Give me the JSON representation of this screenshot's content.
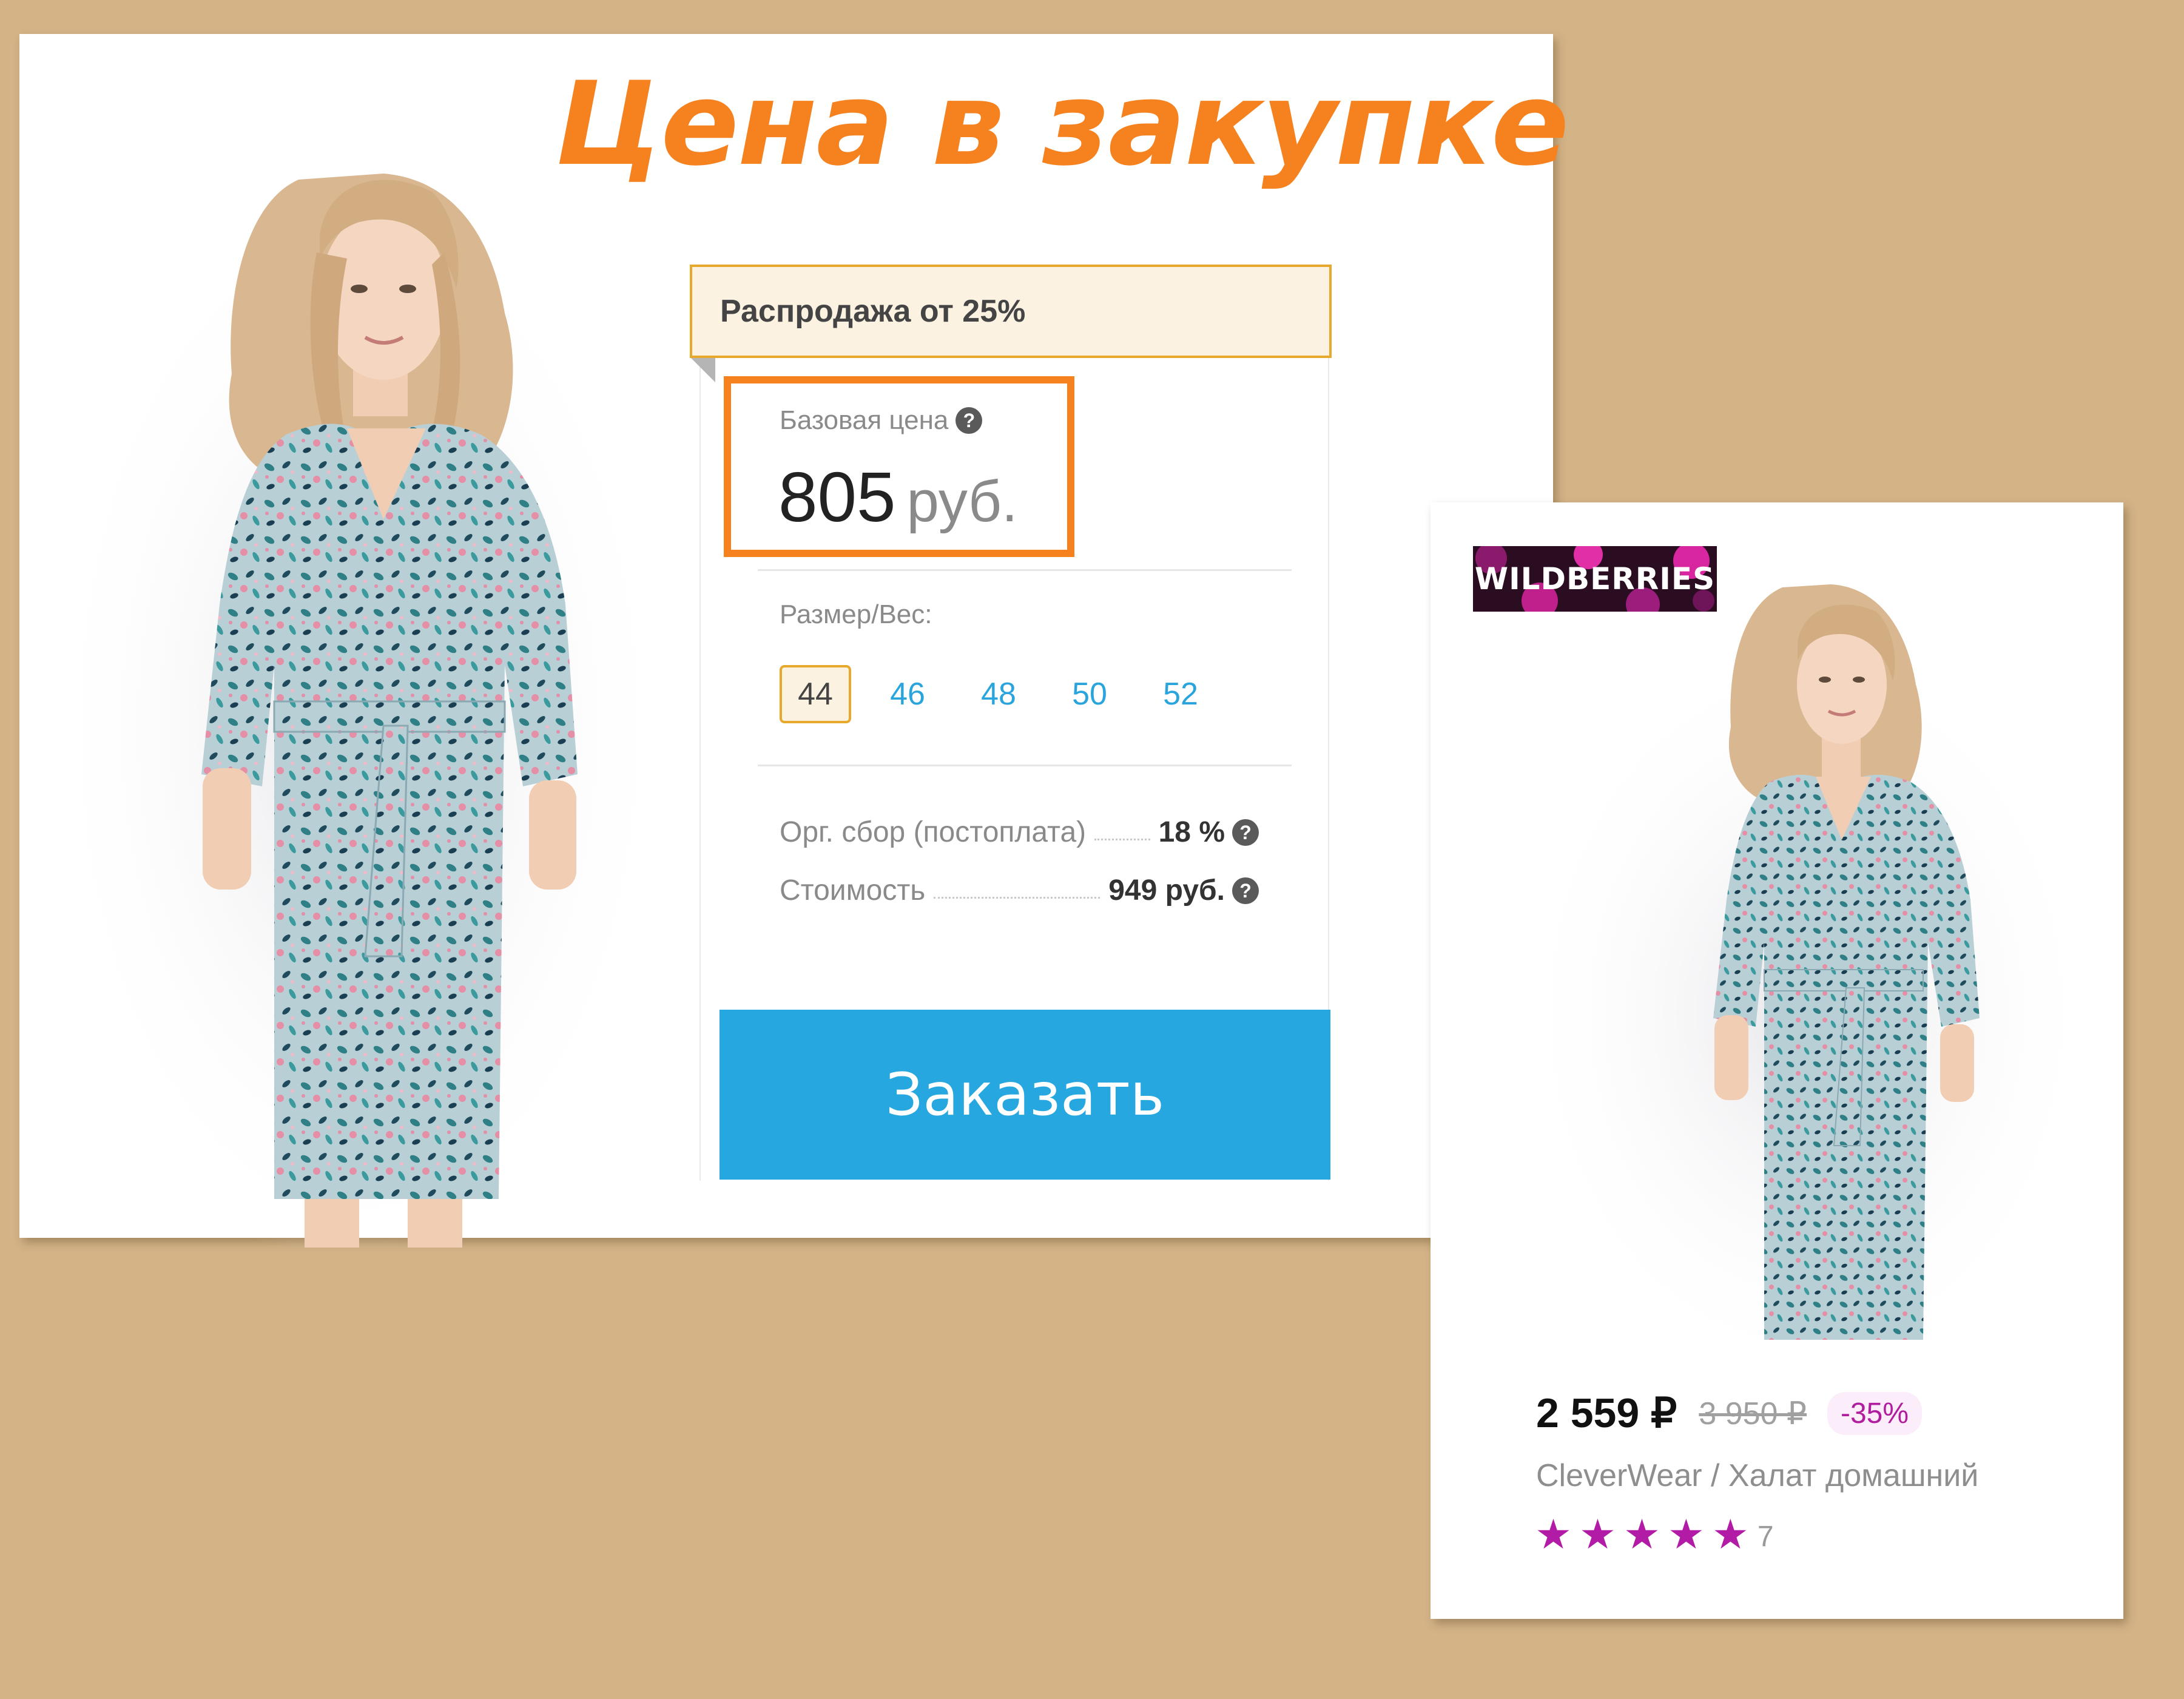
{
  "hero": {
    "title": "Цена в закупке"
  },
  "purchase": {
    "sale_banner": "Распродажа от 25%",
    "base_price_label": "Базовая цена",
    "base_price_amount": "805",
    "base_price_currency": "руб.",
    "size_label": "Размер/Вес:",
    "sizes": [
      "44",
      "46",
      "48",
      "50",
      "52"
    ],
    "selected_size": "44",
    "fee_label": "Орг. сбор (постоплата)",
    "fee_value": "18 %",
    "cost_label": "Стоимость",
    "cost_value": "949 руб.",
    "order_button": "Заказать",
    "help_icon": "question-circle-icon"
  },
  "wildberries": {
    "logo_text": "WILDBERRIES",
    "price": "2 559 ₽",
    "old_price": "3 950 ₽",
    "discount": "-35%",
    "title": "CleverWear / Халат домашний",
    "rating": 5,
    "review_count": "7"
  },
  "colors": {
    "accent_orange": "#f5821f",
    "order_blue": "#27a7e0",
    "wb_purple": "#b21ba6",
    "background": "#d4b387"
  }
}
